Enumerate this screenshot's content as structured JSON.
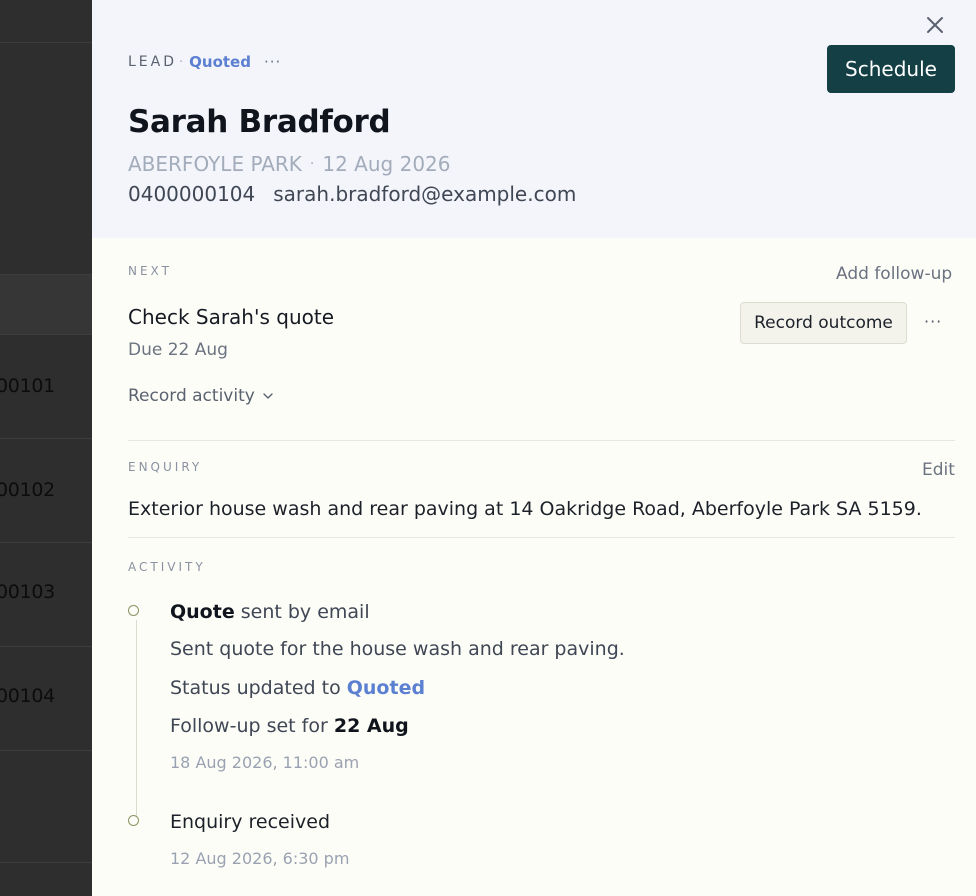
{
  "background_list": {
    "numbers": [
      "00101",
      "00102",
      "00103",
      "00104"
    ]
  },
  "header": {
    "lead_label": "LEAD",
    "status": "Quoted",
    "more_icon": "ellipsis-icon",
    "schedule_label": "Schedule",
    "name": "Sarah Bradford",
    "suburb": "ABERFOYLE PARK",
    "date": "12 Aug 2026",
    "phone": "0400000104",
    "email": "sarah.bradford@example.com",
    "close_icon": "close-icon"
  },
  "next": {
    "section_label": "NEXT",
    "add_follow_up": "Add follow-up",
    "task_title": "Check Sarah's quote",
    "due": "Due 22 Aug",
    "record_outcome": "Record outcome",
    "record_activity": "Record activity"
  },
  "enquiry": {
    "section_label": "ENQUIRY",
    "edit_label": "Edit",
    "text": "Exterior house wash and rear paving at 14 Oakridge Road, Aberfoyle Park SA 5159."
  },
  "activity": {
    "section_label": "ACTIVITY",
    "items": [
      {
        "title_bold": "Quote",
        "title_rest": " sent by email",
        "details": [
          "Sent quote for the house wash and rear paving."
        ],
        "status_prefix": "Status updated to ",
        "status_value": "Quoted",
        "followup_prefix": "Follow-up set for ",
        "followup_value": "22 Aug",
        "time": "18 Aug 2026, 11:00 am"
      },
      {
        "title": "Enquiry received",
        "time": "12 Aug 2026, 6:30 pm"
      }
    ]
  },
  "colors": {
    "accent": "#133f45",
    "status_blue": "#5b7fd1",
    "header_bg": "#f3f5fa",
    "body_bg": "#fdfdf8"
  }
}
